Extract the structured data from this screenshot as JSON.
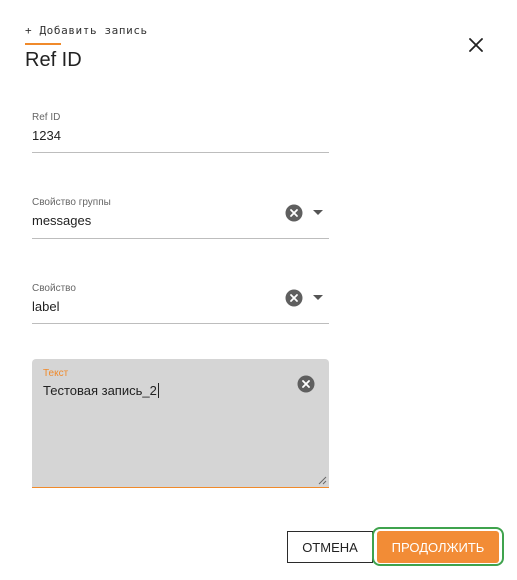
{
  "header": {
    "breadcrumb": "+ Добавить запись",
    "title": "Ref ID"
  },
  "fields": [
    {
      "label": "Ref ID",
      "value": "1234"
    },
    {
      "label": "Свойство группы",
      "value": "messages"
    },
    {
      "label": "Свойство",
      "value": "label"
    }
  ],
  "textarea": {
    "label": "Текст",
    "value": "Тестовая запись_2"
  },
  "actions": {
    "cancel_label": "ОТМЕНА",
    "continue_label": "ПРОДОЛЖИТЬ"
  },
  "icons": {
    "close": "close-icon",
    "clear": "clear-circle-icon",
    "dropdown": "chevron-down-icon",
    "resize": "resize-handle-icon"
  },
  "colors": {
    "accent": "#f08a2b",
    "continue_button": "#f28c36",
    "highlight_ring": "#3fa34d",
    "textarea_bg": "#d5d5d5"
  }
}
